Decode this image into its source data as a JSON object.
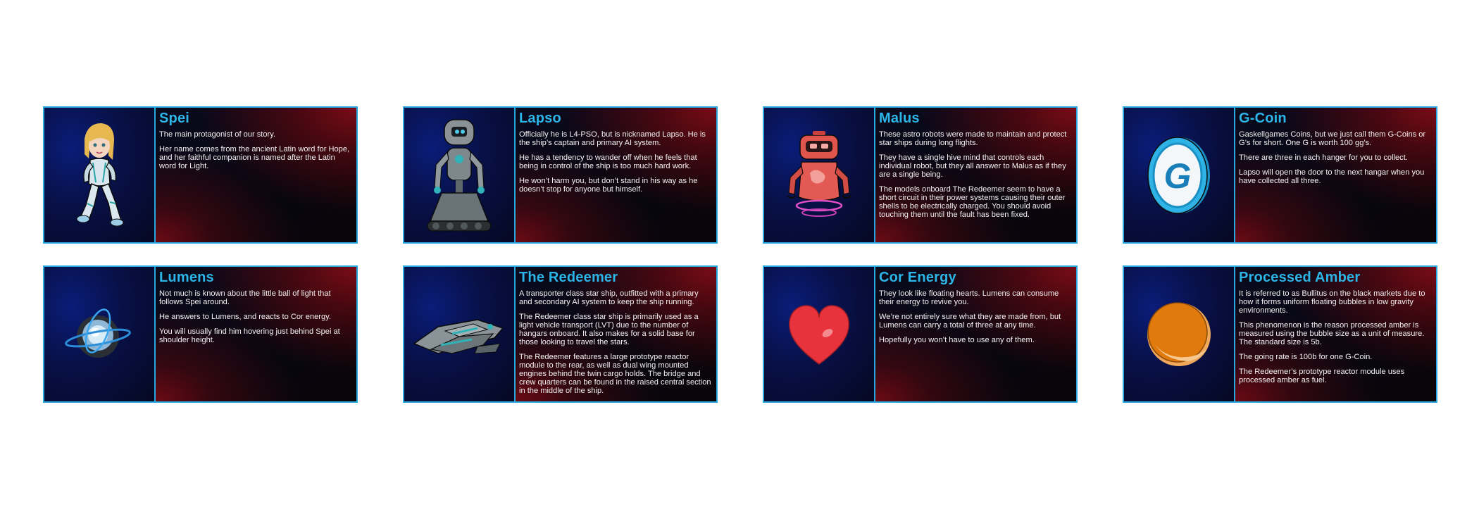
{
  "cards": [
    {
      "title": "Spei",
      "paragraphs": [
        "The main protagonist of our story.",
        "Her name comes from the ancient Latin word for Hope, and her faithful companion is named after the Latin word for Light."
      ]
    },
    {
      "title": "Lapso",
      "paragraphs": [
        "Officially he is L4-PSO, but is nicknamed Lapso. He is the ship’s captain and primary AI system.",
        "He has a tendency to wander off when he feels that being in control of the ship is too much hard work.",
        "He won’t harm you, but don’t stand in his way as he doesn’t stop for anyone but himself."
      ]
    },
    {
      "title": "Malus",
      "paragraphs": [
        "These astro robots were made to maintain and protect star ships during long flights.",
        "They have a single hive mind that controls each individual robot, but they all answer to Malus as if they are a single being.",
        "The models onboard The Redeemer seem to have a short circuit in their power systems causing their outer shells to be electrically charged. You should avoid touching them until the fault has been fixed."
      ]
    },
    {
      "title": "G-Coin",
      "paragraphs": [
        "Gaskellgames Coins, but we just call them G-Coins or G’s for short. One G is worth 100 gg’s.",
        "There are three in each hanger for you to collect.",
        "Lapso will open the door to the next hangar when you have collected all three."
      ]
    },
    {
      "title": "Lumens",
      "paragraphs": [
        "Not much is known about the little ball of light that follows Spei around.",
        "He answers to Lumens, and reacts to Cor energy.",
        "You will usually find him hovering just behind Spei at shoulder height."
      ]
    },
    {
      "title": "The Redeemer",
      "paragraphs": [
        "A transporter class star ship, outfitted with a primary and secondary AI system to keep the ship running.",
        "The Redeemer class star ship is primarily used as a light vehicle transport (LVT) due to the number of hangars onboard. It also makes for a solid base for those looking to travel the stars.",
        "The Redeemer features a large prototype reactor module to the rear, as well as dual wing mounted engines behind the twin cargo holds. The bridge and crew quarters can be found in the raised central section in the middle of the ship."
      ]
    },
    {
      "title": "Cor Energy",
      "paragraphs": [
        "They look like floating hearts. Lumens can consume their energy to revive you.",
        "We’re not entirely sure what they are made from, but Lumens can carry a total of three at any time.",
        "Hopefully you won’t have to use any of them."
      ]
    },
    {
      "title": "Processed Amber",
      "paragraphs": [
        "It is referred to as Bullitus on the black markets due to how it forms uniform floating bubbles in low gravity environments.",
        "This phenomenon is the reason processed amber is measured using the bubble size as a unit of measure. The standard size is 5b.",
        "The going rate is 100b for one G-Coin.",
        "The Redeemer’s prototype reactor module uses processed amber as fuel."
      ]
    }
  ],
  "icons": {
    "spei": "girl-character-icon",
    "lapso": "robot-tank-icon",
    "malus": "red-astro-robot-icon",
    "gcoin": "g-coin-icon",
    "lumens": "light-orb-icon",
    "redeemer": "starship-icon",
    "cor": "heart-icon",
    "amber": "amber-bubble-icon"
  },
  "colors": {
    "border": "#29a8e0",
    "title": "#2cb6e8",
    "text": "#f2f2f2",
    "heart": "#e8323c",
    "amber": "#e07a0c"
  }
}
